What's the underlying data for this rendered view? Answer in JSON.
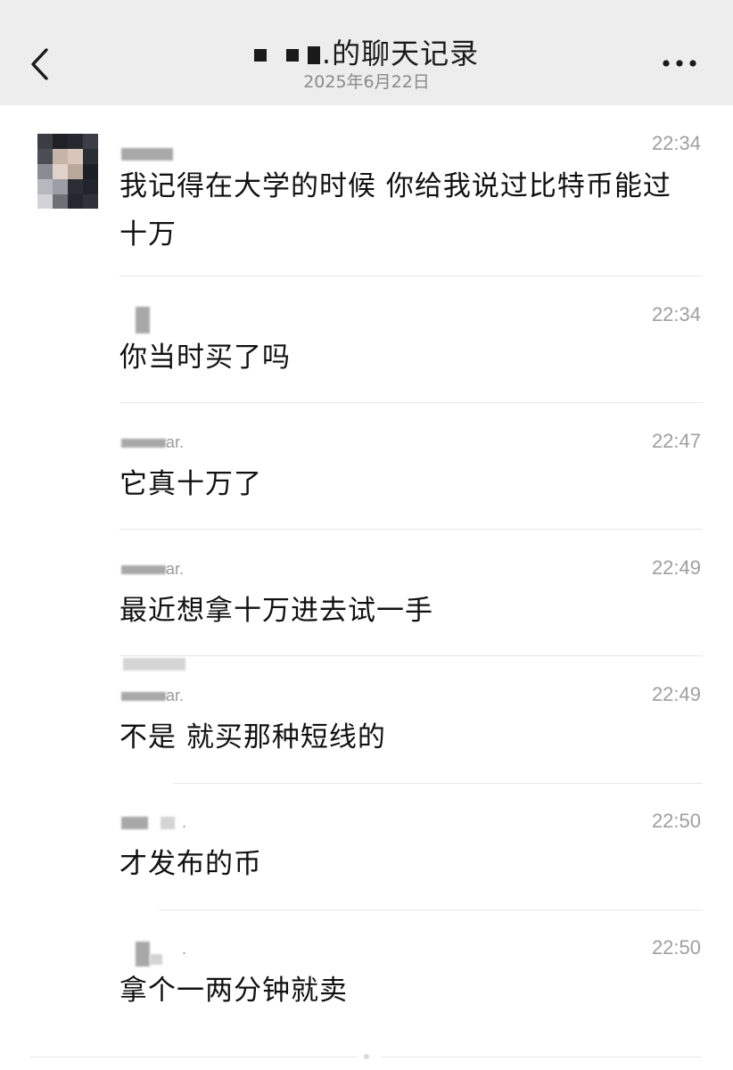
{
  "header": {
    "title_suffix": ".的聊天记录",
    "subtitle": "2025年6月22日",
    "back_icon": "chevron-left-icon",
    "more_icon": "more-horizontal-icon"
  },
  "messages": [
    {
      "time": "22:34",
      "text": "我记得在大学的时候 你给我说过比特币能过十万"
    },
    {
      "time": "22:34",
      "text": "你当时买了吗"
    },
    {
      "time": "22:47",
      "text": "它真十万了",
      "sender_tail": "ar."
    },
    {
      "time": "22:49",
      "text": "最近想拿十万进去试一手",
      "sender_tail": "ar."
    },
    {
      "time": "22:49",
      "text": "不是 就买那种短线的",
      "sender_tail": "ar."
    },
    {
      "time": "22:50",
      "text": "才发布的币",
      "sender_tail": "."
    },
    {
      "time": "22:50",
      "text": "拿个一两分钟就卖",
      "sender_tail": "."
    }
  ]
}
